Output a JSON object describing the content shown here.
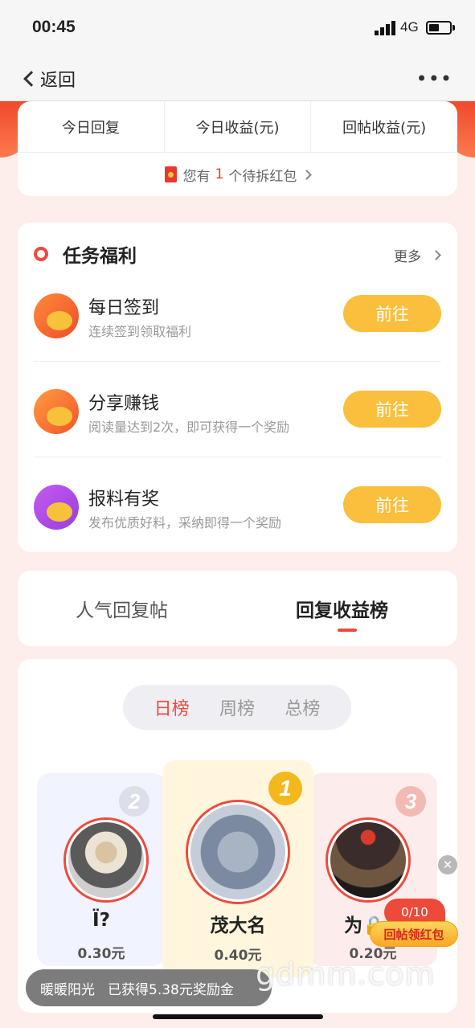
{
  "status_bar": {
    "time": "00:45",
    "network": "4G"
  },
  "nav": {
    "back_label": "返回",
    "more_label": "•••"
  },
  "stats": {
    "columns": [
      "今日回复",
      "今日收益(元)",
      "回帖收益(元)"
    ],
    "redpacket_prefix": "您有",
    "redpacket_count": "1",
    "redpacket_suffix": "个待拆红包"
  },
  "tasks": {
    "title": "任务福利",
    "more_label": "更多",
    "items": [
      {
        "name": "每日签到",
        "desc": "连续签到领取福利",
        "button": "前往",
        "icon": "calendar-checkin-icon"
      },
      {
        "name": "分享赚钱",
        "desc": "阅读量达到2次，即可获得一个奖励",
        "button": "前往",
        "icon": "share-icon"
      },
      {
        "name": "报料有奖",
        "desc": "发布优质好料，采纳即得一个奖励",
        "button": "前往",
        "icon": "megaphone-icon"
      }
    ]
  },
  "tabs": {
    "items": [
      "人气回复帖",
      "回复收益榜"
    ],
    "active": 1
  },
  "board": {
    "segments": [
      "日榜",
      "周榜",
      "总榜"
    ],
    "active_segment": 0,
    "podium": [
      {
        "rank": "2",
        "name": "Ï?",
        "amount": "0.30元"
      },
      {
        "rank": "1",
        "name": "茂大名",
        "amount": "0.40元"
      },
      {
        "rank": "3",
        "name": "为🔒",
        "amount": "0.20元"
      }
    ]
  },
  "floating": {
    "close": "✕",
    "count": "0/10",
    "button_label": "回帖领红包"
  },
  "toast": {
    "nickname": "暖暖阳光",
    "message": "已获得5.38元奖励金"
  },
  "watermark": "gdmm.com",
  "colors": {
    "accent": "#ee4a3c",
    "button_yellow": "#f9bf3d"
  }
}
